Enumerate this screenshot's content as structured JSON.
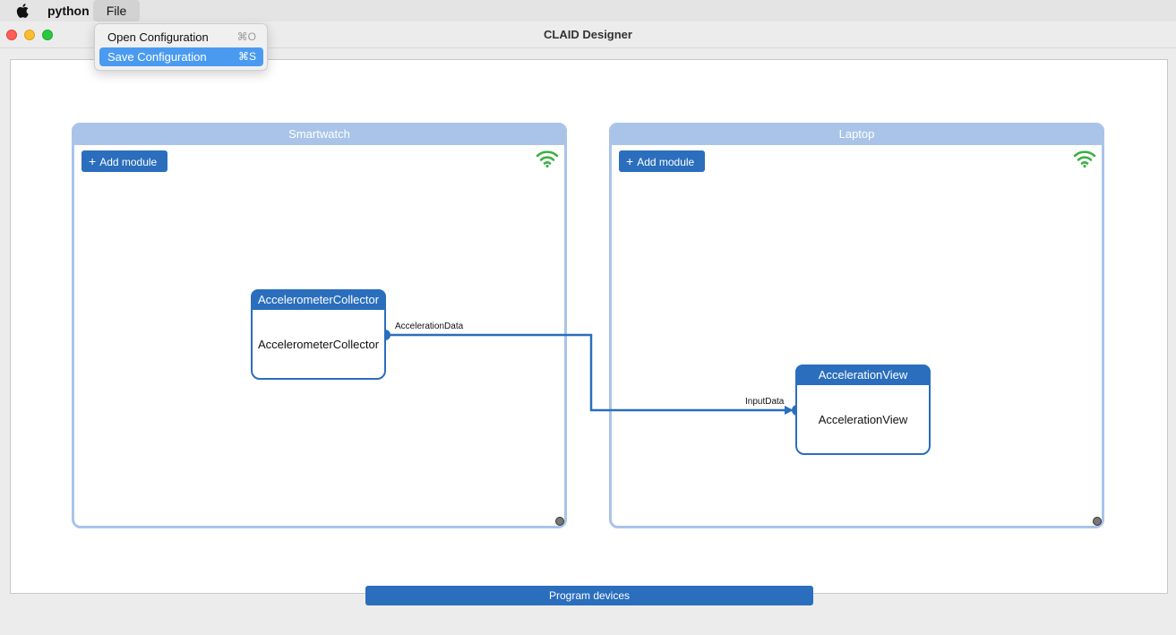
{
  "menubar": {
    "app_name": "python",
    "menu_file": "File",
    "apple_icon": "apple-logo-icon"
  },
  "file_menu": {
    "items": [
      {
        "label": "Open Configuration",
        "shortcut": "⌘O",
        "selected": false
      },
      {
        "label": "Save Configuration",
        "shortcut": "⌘S",
        "selected": true
      }
    ]
  },
  "window": {
    "title": "CLAID Designer"
  },
  "devices": [
    {
      "name": "Smartwatch",
      "add_module_label": "Add module",
      "status_icon": "wifi-icon",
      "status_color": "#3cb043",
      "modules": [
        {
          "title": "AccelerometerCollector",
          "body": "AccelerometerCollector",
          "output_port": "AccelerationData"
        }
      ]
    },
    {
      "name": "Laptop",
      "add_module_label": "Add module",
      "status_icon": "wifi-icon",
      "status_color": "#3cb043",
      "modules": [
        {
          "title": "AccelerationView",
          "body": "AccelerationView",
          "input_port": "InputData"
        }
      ]
    }
  ],
  "program_button": "Program devices",
  "colors": {
    "accent": "#2a6ebd",
    "device_frame": "#a9c4e8",
    "menu_highlight": "#4a9bf0"
  }
}
